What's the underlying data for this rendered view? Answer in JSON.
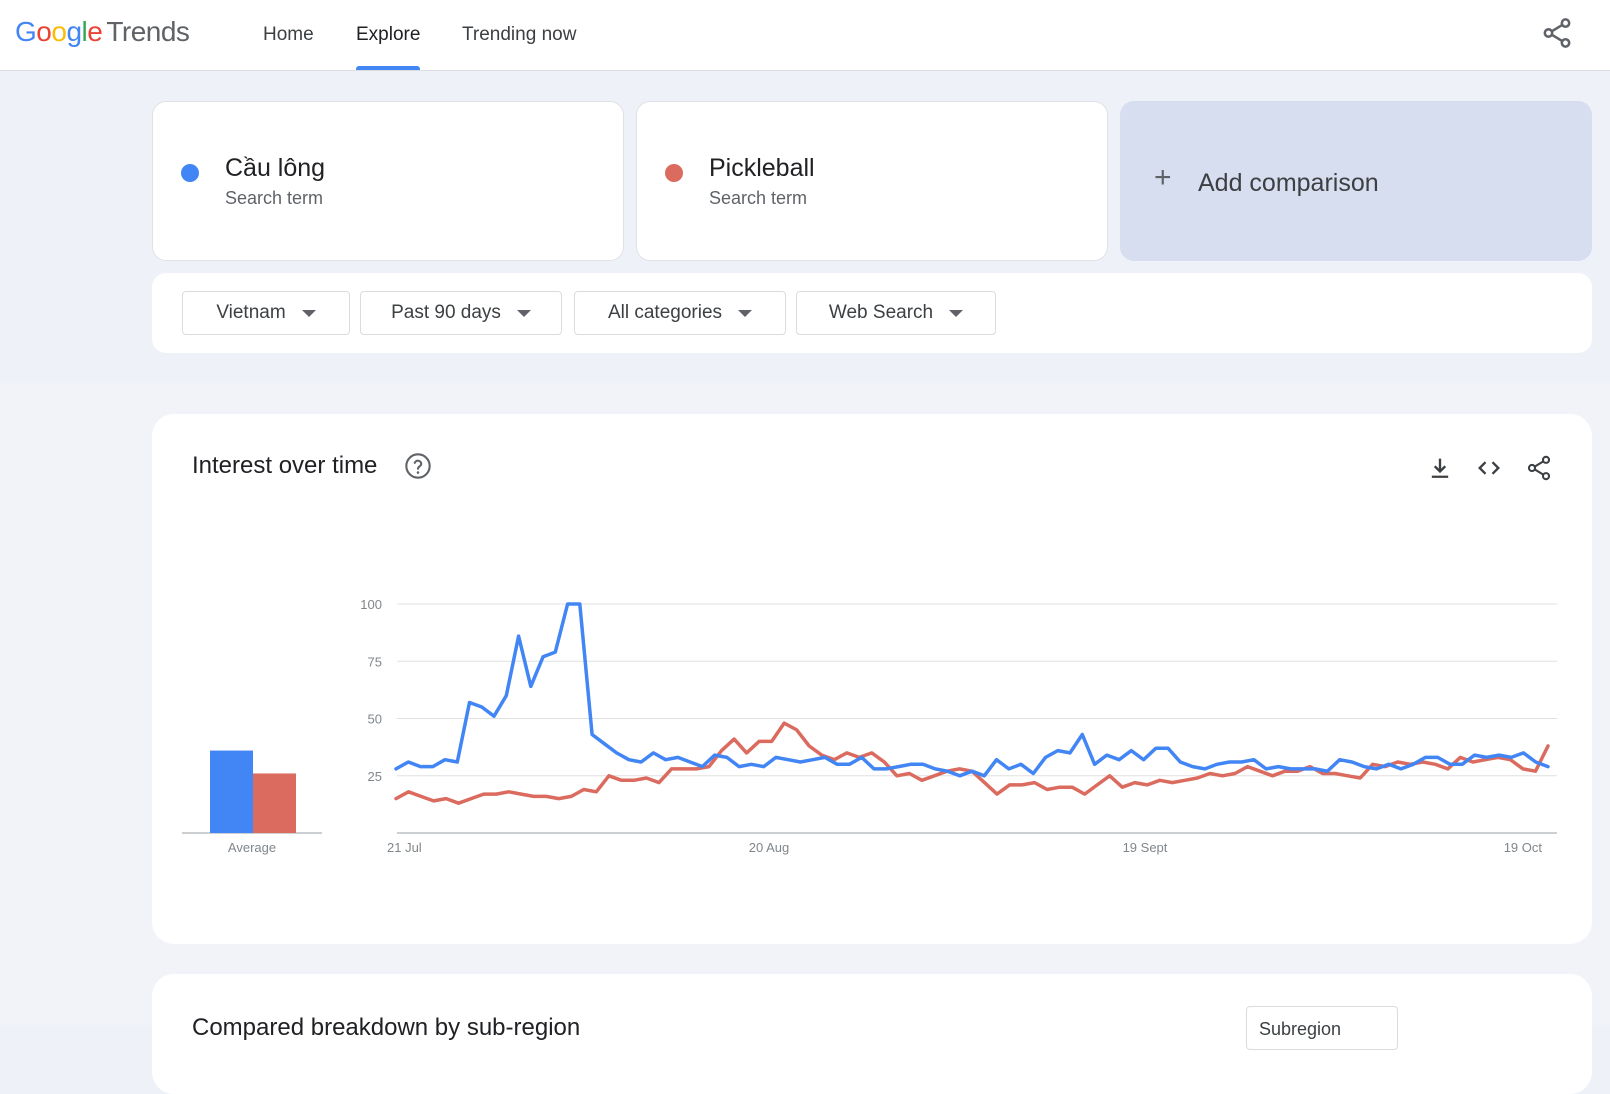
{
  "header": {
    "logo_google": "Google",
    "logo_product": "Trends",
    "nav": [
      {
        "label": "Home",
        "active": false
      },
      {
        "label": "Explore",
        "active": true
      },
      {
        "label": "Trending now",
        "active": false
      }
    ],
    "share_icon": "share-icon"
  },
  "terms": [
    {
      "name": "Cầu lông",
      "type": "Search term",
      "color": "#4285f4"
    },
    {
      "name": "Pickleball",
      "type": "Search term",
      "color": "#db6b5e"
    }
  ],
  "add_comparison": {
    "label": "Add comparison",
    "icon": "plus-icon"
  },
  "filters": [
    {
      "value": "Vietnam"
    },
    {
      "value": "Past 90 days"
    },
    {
      "value": "All categories"
    },
    {
      "value": "Web Search"
    }
  ],
  "interest_panel": {
    "title": "Interest over time",
    "icons": [
      "help-icon",
      "download-icon",
      "embed-icon",
      "share-icon"
    ]
  },
  "chart_data": {
    "type": "line",
    "x_tick_labels": [
      "21 Jul",
      "20 Aug",
      "19 Sept",
      "19 Oct"
    ],
    "y_ticks": [
      25,
      50,
      75,
      100
    ],
    "ylim": [
      0,
      100
    ],
    "grid": true,
    "average_label": "Average",
    "averages": [
      {
        "series": "Cầu lông",
        "value": 36
      },
      {
        "series": "Pickleball",
        "value": 26
      }
    ],
    "series": [
      {
        "name": "Cầu lông",
        "color": "#4285f4",
        "values": [
          28,
          31,
          29,
          29,
          32,
          31,
          57,
          55,
          51,
          60,
          86,
          64,
          77,
          79,
          100,
          100,
          43,
          39,
          35,
          32,
          31,
          35,
          32,
          33,
          31,
          29,
          34,
          33,
          29,
          30,
          29,
          33,
          32,
          31,
          32,
          33,
          30,
          30,
          33,
          28,
          28,
          29,
          30,
          30,
          28,
          27,
          25,
          27,
          25,
          32,
          28,
          30,
          26,
          33,
          36,
          35,
          43,
          30,
          34,
          32,
          36,
          32,
          37,
          37,
          31,
          29,
          28,
          30,
          31,
          31,
          32,
          28,
          29,
          28,
          28,
          28,
          27,
          32,
          31,
          29,
          28,
          30,
          28,
          30,
          33,
          33,
          30,
          30,
          34,
          33,
          34,
          33,
          35,
          31,
          29
        ]
      },
      {
        "name": "Pickleball",
        "color": "#db6b5e",
        "values": [
          15,
          18,
          16,
          14,
          15,
          13,
          15,
          17,
          17,
          18,
          17,
          16,
          16,
          15,
          16,
          19,
          18,
          25,
          23,
          23,
          24,
          22,
          28,
          28,
          28,
          29,
          36,
          41,
          35,
          40,
          40,
          48,
          45,
          38,
          34,
          32,
          35,
          33,
          35,
          31,
          25,
          26,
          23,
          25,
          27,
          28,
          27,
          22,
          17,
          21,
          21,
          22,
          19,
          20,
          20,
          17,
          21,
          25,
          20,
          22,
          21,
          23,
          22,
          23,
          24,
          26,
          25,
          26,
          29,
          27,
          25,
          27,
          27,
          29,
          26,
          26,
          25,
          24,
          30,
          29,
          31,
          30,
          31,
          30,
          28,
          33,
          31,
          32,
          33,
          32,
          28,
          27,
          38
        ]
      }
    ]
  },
  "next_panel": {
    "title": "Compared breakdown by sub-region",
    "select_value": "Subregion"
  }
}
